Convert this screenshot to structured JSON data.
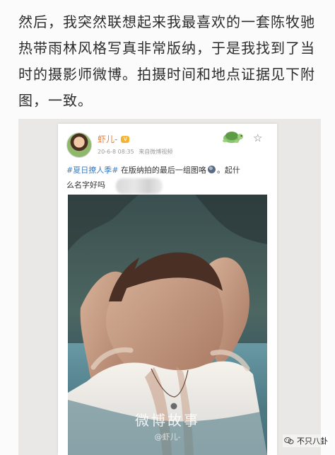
{
  "article": {
    "lines": [
      "然后，我突然联想起来我最喜欢的一套陈牧驰",
      "热带雨林风格写真非常版纳，于是我找到了当",
      "时的摄影师微博。拍摄时间和地点证据见下附",
      "图，一致。"
    ]
  },
  "post": {
    "username": "虾儿-",
    "vip_badge": "V",
    "date": "20-6-8 08:35",
    "source": "来自微博视频",
    "hashtag": "#夏日撩人季#",
    "text_after_hashtag": "在版纳拍的最后一组图咯",
    "text_line1_end": "。起什",
    "text_line2": "么名字好吗",
    "watermark_title": "微博故事",
    "watermark_handle": "@虾儿-"
  },
  "account_badge": {
    "name": "不只八卦"
  },
  "icons": {
    "star": "☆",
    "turtle": "turtle-sticker-icon",
    "avatar": "avatar-icon",
    "chat": "wechat-icon",
    "globe": "globe-emoji-icon"
  },
  "colors": {
    "hashtag": "#3d7bbf",
    "username": "#f07a30",
    "vip": "#f6b333"
  }
}
